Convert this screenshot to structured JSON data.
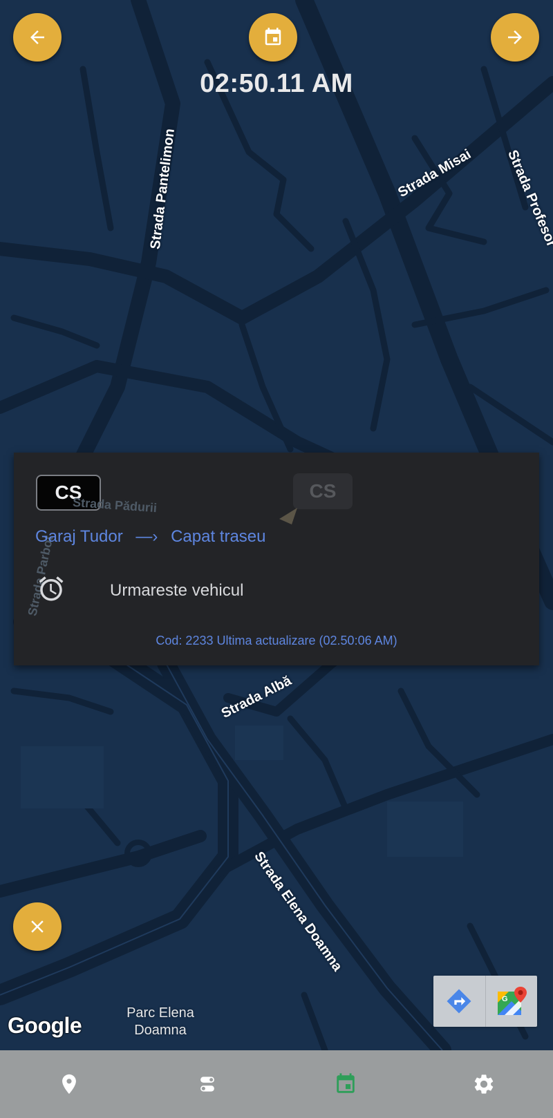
{
  "colors": {
    "map_bg": "#18304d",
    "accent": "#e3ae3c",
    "panel_bg": "#232427",
    "link_blue": "#5e86e0",
    "navbar_bg": "#9a9d9e",
    "nav_active": "#2e9e59",
    "nav_inactive": "#ffffff"
  },
  "header": {
    "time": "02:50.11 AM",
    "prev_icon": "arrow-left-icon",
    "calendar_icon": "calendar-icon",
    "next_icon": "arrow-right-icon"
  },
  "map": {
    "streets": [
      {
        "name": "Strada Pantelimon"
      },
      {
        "name": "Strada Misai"
      },
      {
        "name": "Strada Profesor"
      },
      {
        "name": "Strada Albă"
      },
      {
        "name": "Strada Elena Doamna"
      }
    ],
    "faded_streets": [
      {
        "name": "Strada Pădurii"
      },
      {
        "name": "Strada Parbot"
      }
    ],
    "marker_label": "CS",
    "poi_line1": "Parc Elena",
    "poi_line2": "Doamna",
    "attribution": "Google"
  },
  "panel": {
    "badge": "CS",
    "route_from": "Garaj Tudor",
    "route_arrow": "—›",
    "route_to": "Capat traseu",
    "follow_label": "Urmareste vehicul",
    "follow_icon": "alarm-clock-icon",
    "code_text": "Cod: 2233 Ultima actualizare (02.50:06 AM)"
  },
  "close_icon": "close-icon",
  "map_controls": [
    "directions-icon",
    "google-maps-icon"
  ],
  "navbar": {
    "items": [
      {
        "icon": "location-pin-icon",
        "active": false
      },
      {
        "icon": "route-icon",
        "active": false
      },
      {
        "icon": "calendar-icon",
        "active": true
      },
      {
        "icon": "settings-gear-icon",
        "active": false
      }
    ]
  }
}
